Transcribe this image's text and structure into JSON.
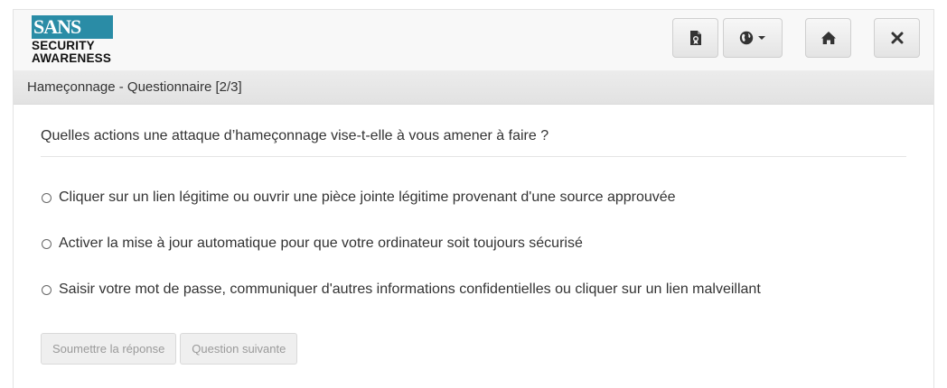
{
  "logo": {
    "brand": "SANS",
    "line1": "SECURITY",
    "line2": "AWARENESS"
  },
  "header": {
    "buttons": [
      {
        "icon": "document-certificate-icon"
      },
      {
        "icon": "globe-language-icon",
        "has_dropdown": true
      },
      {
        "icon": "home-icon"
      },
      {
        "icon": "close-icon"
      }
    ]
  },
  "breadcrumb": "Hameçonnage - Questionnaire [2/3]",
  "question": "Quelles actions une attaque d’hameçonnage vise-t-elle à vous amener à faire ?",
  "options": [
    "Cliquer sur un lien légitime ou ouvrir une pièce jointe légitime provenant d'une source approuvée",
    "Activer la mise à jour automatique pour que votre ordinateur soit toujours sécurisé",
    "Saisir votre mot de passe, communiquer d'autres informations confidentielles ou cliquer sur un lien malveillant"
  ],
  "actions": {
    "submit_label": "Soumettre la réponse",
    "next_label": "Question suivante"
  },
  "colors": {
    "brand": "#2a8ca6"
  }
}
